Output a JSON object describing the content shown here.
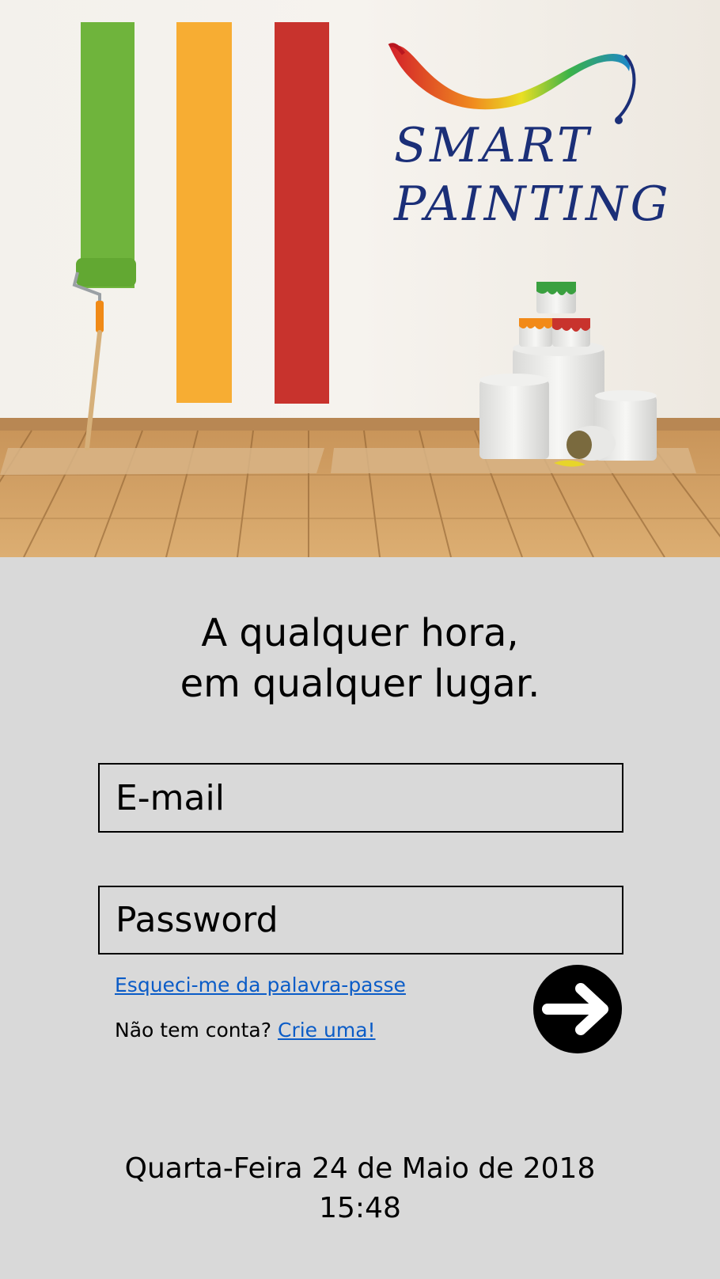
{
  "brand": {
    "line1": "SMART",
    "line2": "PAINTING",
    "colors": {
      "text": "#1b2f78"
    }
  },
  "hero": {
    "stripe_colors": [
      "#6fb43c",
      "#f7ad33",
      "#c8332d"
    ]
  },
  "tagline": {
    "line1": "A qualquer hora,",
    "line2": "em qualquer lugar."
  },
  "form": {
    "email_placeholder": "E-mail",
    "password_placeholder": "Password",
    "forgot_link": "Esqueci-me da palavra-passe",
    "no_account_text": "Não tem conta?",
    "signup_link": "Crie uma!",
    "submit_icon": "arrow-right-icon"
  },
  "footer": {
    "date": "Quarta-Feira 24 de Maio de 2018",
    "time": "15:48"
  },
  "colors": {
    "background": "#d9d9d9",
    "link": "#0b5cc7"
  }
}
